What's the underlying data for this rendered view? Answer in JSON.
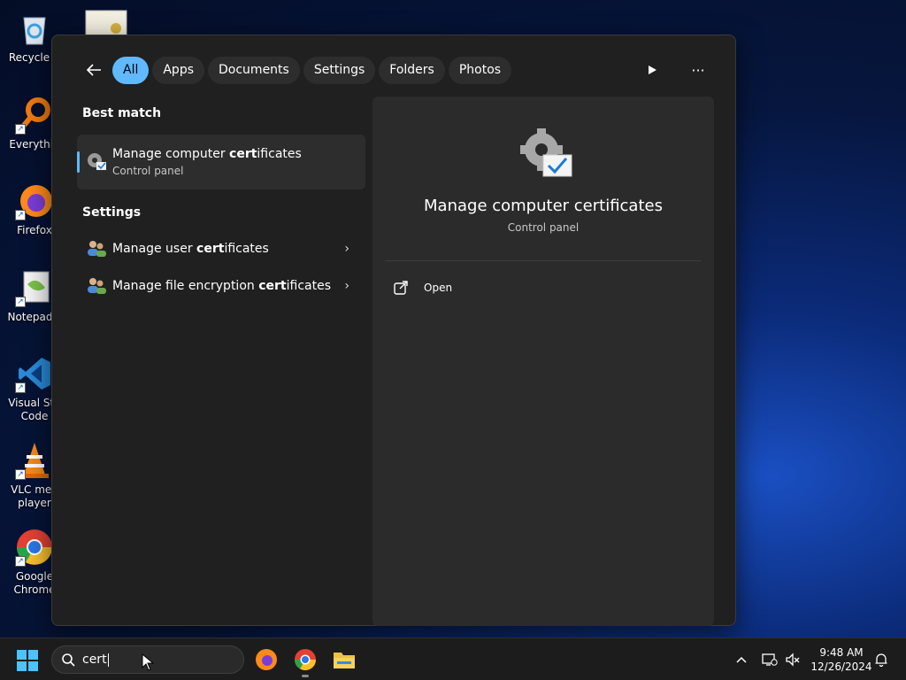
{
  "desktop": {
    "icons": [
      {
        "label": "Recycle B"
      },
      {
        "label": "Everythin"
      },
      {
        "label": "Firefox"
      },
      {
        "label": "Notepad+"
      },
      {
        "label": "Visual Stu\nCode"
      },
      {
        "label": "VLC med\nplayer"
      },
      {
        "label": "Google\nChrome"
      }
    ]
  },
  "search_panel": {
    "filters": [
      "All",
      "Apps",
      "Documents",
      "Settings",
      "Folders",
      "Photos"
    ],
    "active_filter": "All",
    "best_match": {
      "heading": "Best match",
      "title_prefix": "Manage computer ",
      "title_bold": "cert",
      "title_suffix": "ificates",
      "subtitle": "Control panel"
    },
    "settings": {
      "heading": "Settings",
      "items": [
        {
          "prefix": "Manage user ",
          "bold": "cert",
          "suffix": "ificates"
        },
        {
          "prefix": "Manage file encryption ",
          "bold": "cert",
          "suffix": "ificates"
        }
      ]
    },
    "preview": {
      "title": "Manage computer certificates",
      "subtitle": "Control panel",
      "actions": [
        {
          "label": "Open"
        }
      ]
    }
  },
  "taskbar": {
    "search_query": "cert",
    "clock": {
      "time": "9:48 AM",
      "date": "12/26/2024"
    }
  },
  "colors": {
    "accent": "#60b8ff",
    "panel_bg": "#202020",
    "preview_bg": "#2b2b2b"
  },
  "icons": [
    "back-arrow-icon",
    "play-icon",
    "more-icon",
    "gear-check-icon",
    "users-icon",
    "chevron-right-icon",
    "open-external-icon",
    "windows-logo-icon",
    "search-icon"
  ]
}
